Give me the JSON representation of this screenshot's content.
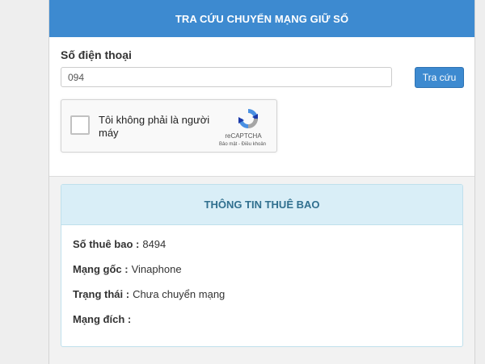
{
  "header": {
    "title": "TRA CỨU CHUYỂN MẠNG GIỮ SỐ"
  },
  "form": {
    "phone_label": "Số điện thoại",
    "phone_value": "094",
    "lookup_button": "Tra cứu"
  },
  "recaptcha": {
    "label": "Tôi không phải là người máy",
    "brand": "reCAPTCHA",
    "terms": "Bảo mật - Điều khoản",
    "logo_icon": "recaptcha-logo-icon",
    "colors": {
      "blue": "#4a90e2",
      "dark_blue": "#1c3aa9",
      "gray": "#a6a6a6"
    }
  },
  "info": {
    "title": "THÔNG TIN THUÊ BAO",
    "rows": [
      {
        "key": "Số thuê bao :",
        "value": "8494"
      },
      {
        "key": "Mạng gốc :",
        "value": "Vinaphone"
      },
      {
        "key": "Trạng thái :",
        "value": "Chưa chuyển mạng"
      },
      {
        "key": "Mạng đích :",
        "value": ""
      }
    ]
  },
  "colors": {
    "accent": "#3d8ad0",
    "info_header_bg": "#d9eef7",
    "info_header_text": "#31708f"
  }
}
